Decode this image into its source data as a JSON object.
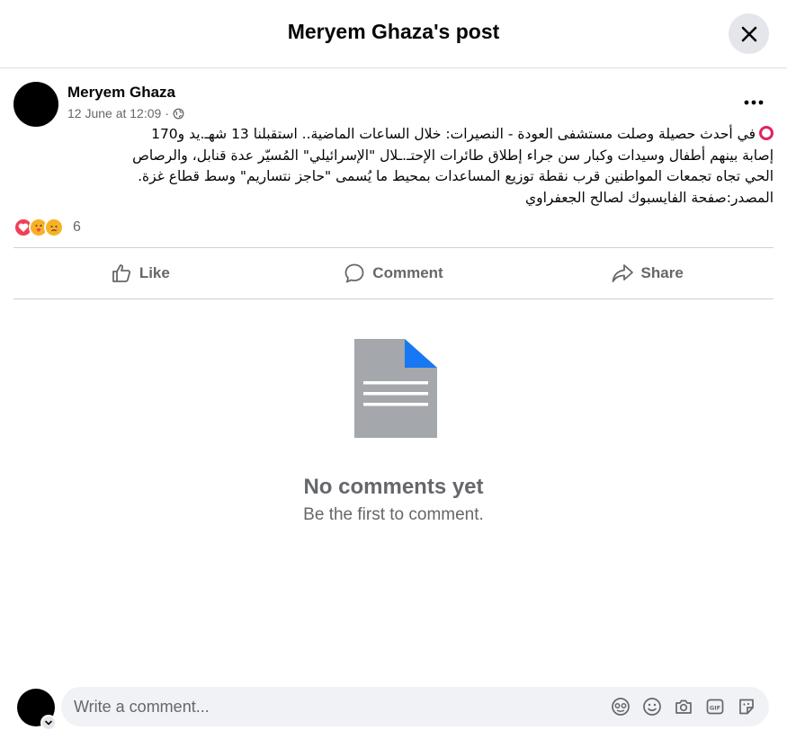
{
  "header": {
    "title": "Meryem Ghaza's post"
  },
  "post": {
    "author": "Meryem Ghaza",
    "timestamp": "12 June at 12:09",
    "separator": "·",
    "audience_icon": "globe-icon",
    "text_lines": [
      "في أحدث حصيلة وصلت مستشفى العودة - النصيرات: خلال الساعات الماضية.. استقبلنا 13 شهـ.يد و170",
      "إصابة بينهم أطفال وسيدات وكبار سن جراء إطلاق طائرات الإحتـ.ـلال \"الإسرائيلي\" المُسيّر عدة قنابل، والرصاص",
      "الحي تجاه تجمعات المواطنين قرب نقطة توزيع المساعدات بمحيط ما يُسمى \"حاجز نتساريم\" وسط قطاع غزة.",
      "المصدر:صفحة الفايسبوك لصالح الجعفراوي"
    ],
    "leading_emoji": "red-circle-icon",
    "reactions": {
      "types": [
        "love",
        "care",
        "sad"
      ],
      "count": "6"
    }
  },
  "actions": {
    "like": "Like",
    "comment": "Comment",
    "share": "Share"
  },
  "comments": {
    "empty_title": "No comments yet",
    "empty_subtitle": "Be the first to comment."
  },
  "composer": {
    "placeholder": "Write a comment...",
    "icons": [
      "avatar-sticker-icon",
      "emoji-icon",
      "camera-icon",
      "gif-icon",
      "sticker-icon"
    ],
    "gif_label": "GIF"
  },
  "colors": {
    "accent_blue": "#1877f2",
    "secondary_text": "#65676b",
    "divider": "#ced0d4",
    "input_bg": "#f0f2f5"
  }
}
